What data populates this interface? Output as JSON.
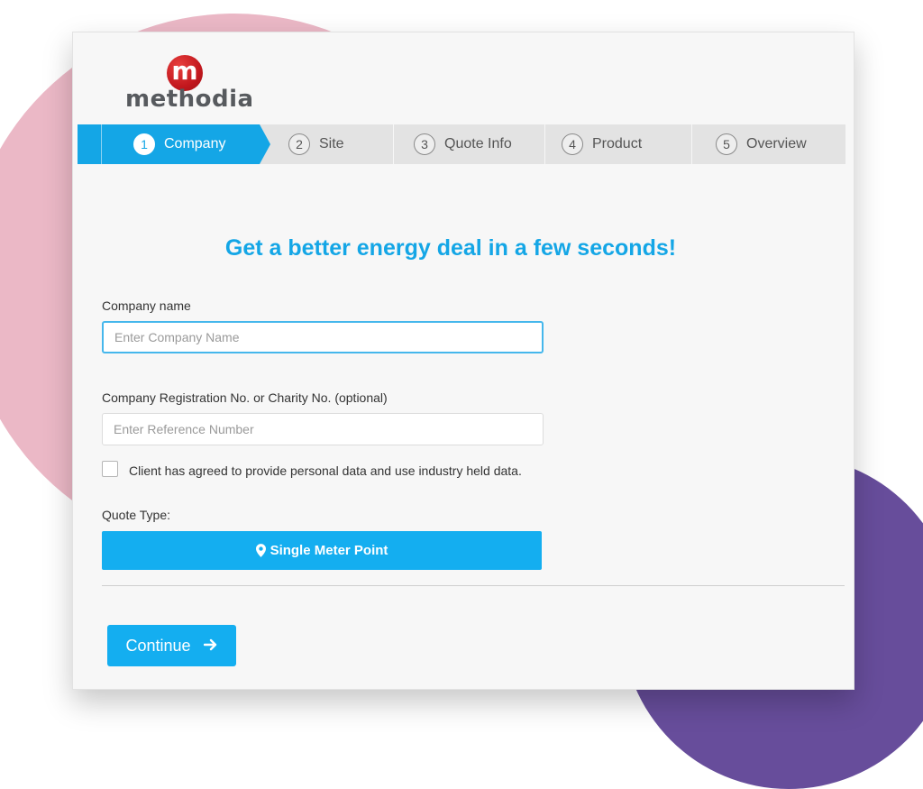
{
  "brand": {
    "logo_letter": "m",
    "logo_text": "methodia",
    "accent": "#14a6e6",
    "logo_red": "#c3181e"
  },
  "steps": [
    {
      "num": "1",
      "label": "Company",
      "active": true
    },
    {
      "num": "2",
      "label": "Site"
    },
    {
      "num": "3",
      "label": "Quote Info"
    },
    {
      "num": "4",
      "label": "Product"
    },
    {
      "num": "5",
      "label": "Overview"
    }
  ],
  "headline": "Get a better energy deal in a few seconds!",
  "form": {
    "company_name_label": "Company name",
    "company_name_placeholder": "Enter Company Name",
    "reg_label": "Company Registration No. or Charity No. (optional)",
    "reg_placeholder": "Enter Reference Number",
    "consent_label": "Client has agreed to provide personal data and use industry held data.",
    "quote_type_label": "Quote Type:",
    "quote_type_button": "Single Meter Point",
    "quote_type_icon": "map-pin-icon"
  },
  "actions": {
    "continue_label": "Continue",
    "continue_icon": "arrow-right-icon"
  }
}
